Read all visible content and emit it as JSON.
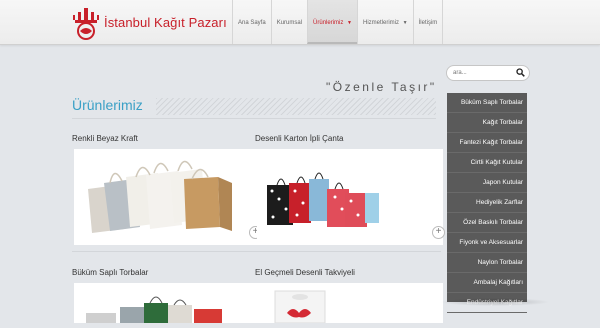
{
  "brand": {
    "name": "İstanbul Kağıt Pazarı",
    "color": "#c8202a"
  },
  "nav": {
    "items": [
      {
        "label": "Ana Sayfa",
        "active": false
      },
      {
        "label": "Kurumsal",
        "active": false
      },
      {
        "label": "Ürünlerimiz",
        "active": true,
        "has_dropdown": true
      },
      {
        "label": "Hizmetlerimiz",
        "active": false,
        "has_dropdown": true
      },
      {
        "label": "İletişim",
        "active": false
      }
    ]
  },
  "slogan": "\"Özenle Taşır\"",
  "section_title": "Ürünlerimiz",
  "products": [
    {
      "name": "Renkli Beyaz Kraft",
      "image": "kraft-bags-image"
    },
    {
      "name": "Desenli Karton İpli Çanta",
      "image": "polka-dot-bags-image"
    },
    {
      "name": "Büküm Saplı Torbalar",
      "image": "twisted-handle-bags-image"
    },
    {
      "name": "El Geçmeli Desenli Takviyeli",
      "image": "die-cut-handle-bag-image"
    }
  ],
  "search": {
    "placeholder": "ara..."
  },
  "categories": [
    "Büküm Saplı Torbalar",
    "Kağıt Torbalar",
    "Fantezi Kağıt Torbalar",
    "Cirtli Kağıt Kutular",
    "Japon Kutular",
    "Hediyelik Zarflar",
    "Özel Baskılı Torbalar",
    "Fiyonk ve Aksesuarlar",
    "Naylon Torbalar",
    "Ambalaj Kağıtları",
    "Endüstriyel Kağıtlar"
  ],
  "colors": {
    "accent_blue": "#3aa0c6",
    "sidebar_bg": "#5a5a5a",
    "page_bg": "#e3e6ea"
  }
}
